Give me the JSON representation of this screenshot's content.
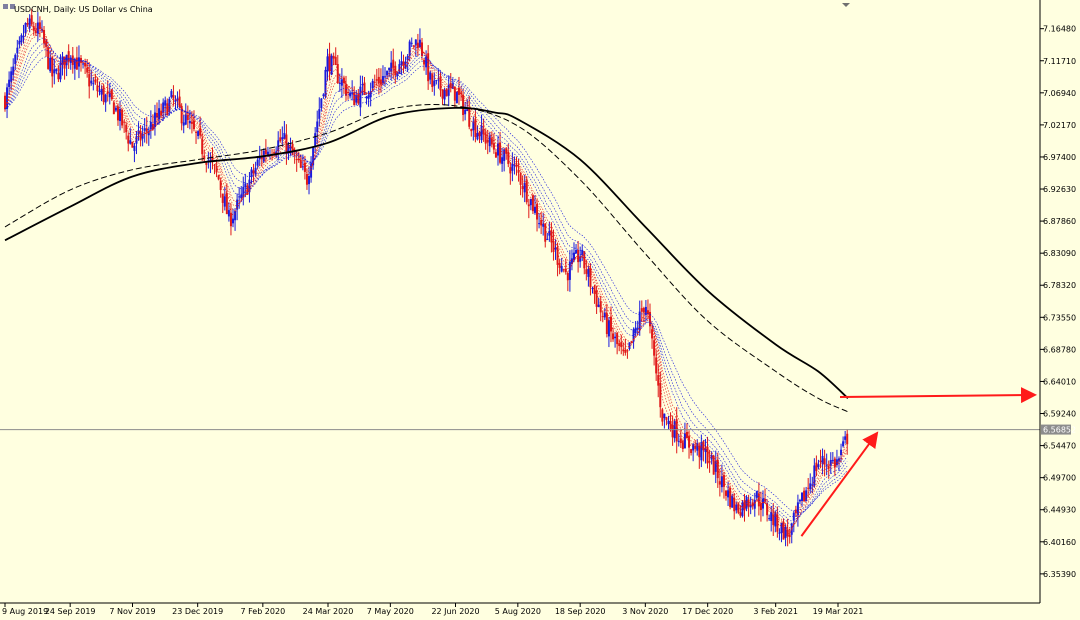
{
  "header": {
    "title": "USDCNH, Daily:  US Dollar vs China"
  },
  "current_price_label": "6.56852",
  "colors": {
    "background": "#ffffe0",
    "bull_candle": "#1a1adc",
    "bear_candle": "#e01818",
    "ma_long": "#000000",
    "ribbon_fast": "#e01818",
    "ribbon_slow": "#1a1adc",
    "annotation_arrow": "#ff1a1a",
    "price_line": "#8c8c8c"
  },
  "chart_data": {
    "type": "candlestick",
    "title": "USDCNH, Daily:  US Dollar vs China",
    "xlabel": "",
    "ylabel": "",
    "ylim": [
      6.318,
      7.203
    ],
    "y_ticks": [
      "7.16480",
      "7.11710",
      "7.06940",
      "7.02170",
      "6.97400",
      "6.92630",
      "6.87860",
      "6.83090",
      "6.78320",
      "6.73550",
      "6.68780",
      "6.64010",
      "6.59240",
      "6.54470",
      "6.49700",
      "6.44930",
      "6.40160",
      "6.35390"
    ],
    "x_ticks": [
      "9 Aug 2019",
      "24 Sep 2019",
      "7 Nov 2019",
      "23 Dec 2019",
      "7 Feb 2020",
      "24 Mar 2020",
      "7 May 2020",
      "22 Jun 2020",
      "5 Aug 2020",
      "18 Sep 2020",
      "3 Nov 2020",
      "17 Dec 2020",
      "3 Feb 2021",
      "19 Mar 2021"
    ],
    "grid": false,
    "legend": "none",
    "current_price": 6.56852,
    "close_path": [
      [
        "9 Aug 2019",
        7.06
      ],
      [
        "24 Aug 2019",
        7.17
      ],
      [
        "3 Sep 2019",
        7.16
      ],
      [
        "12 Sep 2019",
        7.09
      ],
      [
        "24 Sep 2019",
        7.13
      ],
      [
        "10 Oct 2019",
        7.08
      ],
      [
        "25 Oct 2019",
        7.05
      ],
      [
        "7 Nov 2019",
        6.99
      ],
      [
        "20 Nov 2019",
        7.02
      ],
      [
        "5 Dec 2019",
        7.06
      ],
      [
        "23 Dec 2019",
        7.0
      ],
      [
        "7 Jan 2020",
        6.94
      ],
      [
        "14 Jan 2020",
        6.88
      ],
      [
        "20 Jan 2020",
        6.9
      ],
      [
        "7 Feb 2020",
        6.98
      ],
      [
        "21 Feb 2020",
        7.0
      ],
      [
        "3 Mar 2020",
        6.96
      ],
      [
        "9 Mar 2020",
        6.94
      ],
      [
        "24 Mar 2020",
        7.12
      ],
      [
        "10 Apr 2020",
        7.06
      ],
      [
        "7 May 2020",
        7.1
      ],
      [
        "27 May 2020",
        7.15
      ],
      [
        "5 Jun 2020",
        7.08
      ],
      [
        "22 Jun 2020",
        7.07
      ],
      [
        "5 Jul 2020",
        7.02
      ],
      [
        "5 Aug 2020",
        6.95
      ],
      [
        "25 Aug 2020",
        6.86
      ],
      [
        "8 Sep 2020",
        6.8
      ],
      [
        "18 Sep 2020",
        6.83
      ],
      [
        "5 Oct 2020",
        6.73
      ],
      [
        "20 Oct 2020",
        6.67
      ],
      [
        "3 Nov 2020",
        6.76
      ],
      [
        "15 Nov 2020",
        6.59
      ],
      [
        "1 Dec 2020",
        6.55
      ],
      [
        "17 Dec 2020",
        6.53
      ],
      [
        "6 Jan 2021",
        6.45
      ],
      [
        "20 Jan 2021",
        6.47
      ],
      [
        "3 Feb 2021",
        6.43
      ],
      [
        "12 Feb 2021",
        6.41
      ],
      [
        "25 Feb 2021",
        6.48
      ],
      [
        "5 Mar 2021",
        6.52
      ],
      [
        "19 Mar 2021",
        6.52
      ],
      [
        "26 Mar 2021",
        6.56
      ]
    ],
    "series": [
      {
        "values": [
          [
            "9 Aug 2019",
            6.85
          ],
          [
            "24 Sep 2019",
            6.9
          ],
          [
            "7 Nov 2019",
            6.945
          ],
          [
            "23 Dec 2019",
            6.965
          ],
          [
            "7 Feb 2020",
            6.975
          ],
          [
            "24 Mar 2020",
            6.995
          ],
          [
            "7 May 2020",
            7.035
          ],
          [
            "22 Jun 2020",
            7.047
          ],
          [
            "20 Jul 2020",
            7.04
          ],
          [
            "5 Aug 2020",
            7.03
          ],
          [
            "18 Sep 2020",
            6.97
          ],
          [
            "3 Nov 2020",
            6.87
          ],
          [
            "17 Dec 2020",
            6.775
          ],
          [
            "3 Feb 2021",
            6.695
          ],
          [
            "5 Mar 2021",
            6.655
          ],
          [
            "26 Mar 2021",
            6.615
          ]
        ]
      },
      {
        "values": [
          [
            "9 Aug 2019",
            6.87
          ],
          [
            "24 Sep 2019",
            6.925
          ],
          [
            "7 Nov 2019",
            6.955
          ],
          [
            "23 Dec 2019",
            6.97
          ],
          [
            "7 Feb 2020",
            6.985
          ],
          [
            "24 Mar 2020",
            7.01
          ],
          [
            "7 May 2020",
            7.045
          ],
          [
            "22 Jun 2020",
            7.05
          ],
          [
            "5 Aug 2020",
            7.02
          ],
          [
            "18 Sep 2020",
            6.94
          ],
          [
            "3 Nov 2020",
            6.83
          ],
          [
            "17 Dec 2020",
            6.73
          ],
          [
            "3 Feb 2021",
            6.655
          ],
          [
            "5 Mar 2021",
            6.615
          ],
          [
            "26 Mar 2021",
            6.595
          ]
        ]
      }
    ],
    "annotations": [
      {
        "type": "arrow",
        "from": [
          "19 Mar 2021",
          6.617
        ],
        "to": "right edge",
        "direction": "horizontal"
      },
      {
        "type": "arrow",
        "from": [
          "12 Feb 2021",
          6.41
        ],
        "to": [
          "26 Mar 2021",
          6.555
        ]
      }
    ]
  }
}
